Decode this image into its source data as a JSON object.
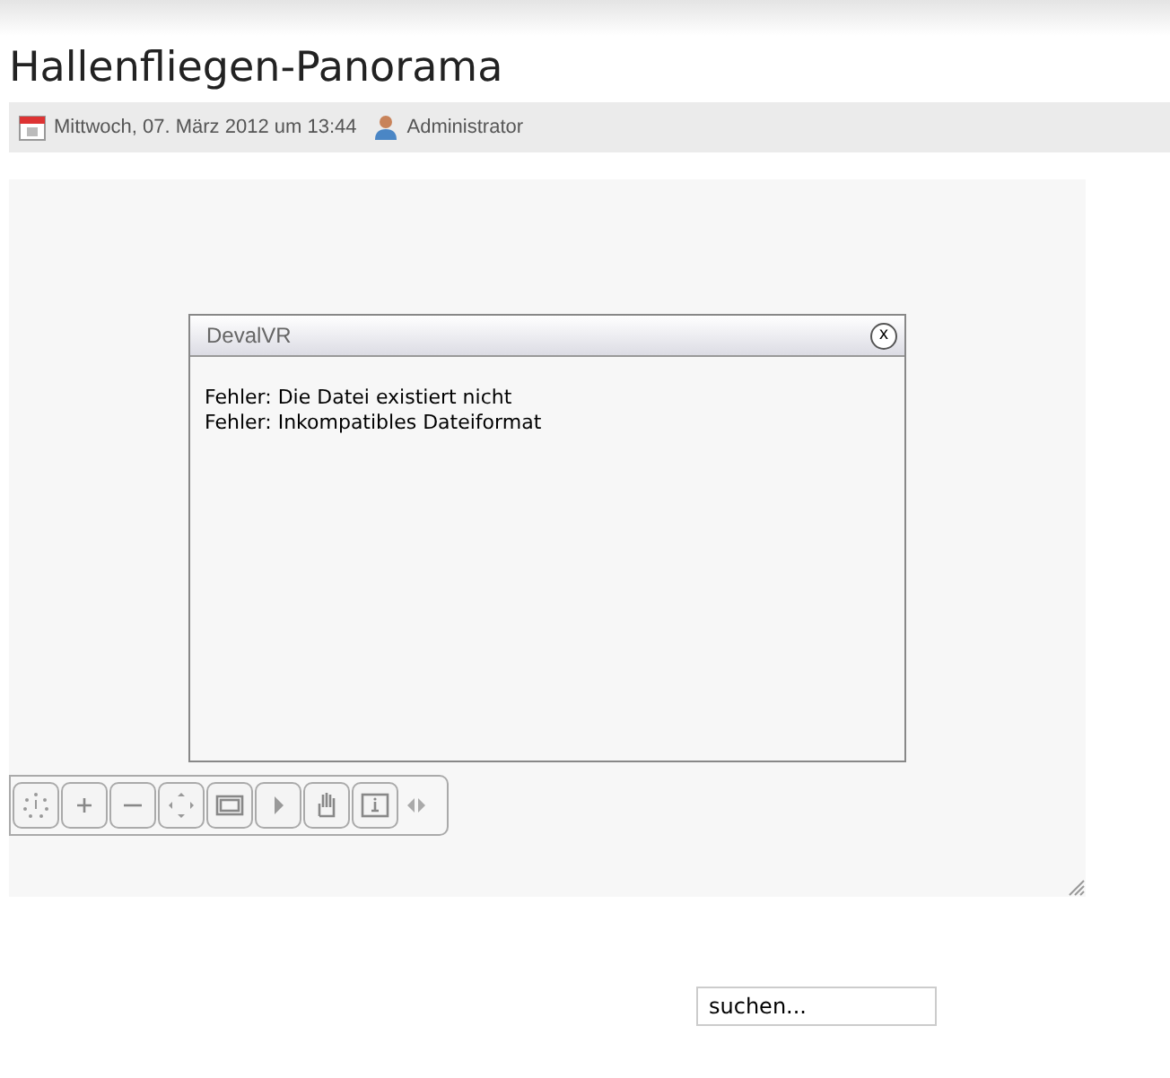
{
  "article": {
    "title": "Hallenfliegen-Panorama",
    "date": "Mittwoch, 07. März 2012 um 13:44",
    "author": "Administrator"
  },
  "viewer": {
    "dialog": {
      "title": "DevalVR",
      "close": "x",
      "messages": [
        "Fehler: Die Datei existiert nicht",
        "Fehler: Inkompatibles Dateiformat"
      ]
    },
    "toolbar": [
      {
        "kind": "autorotate"
      },
      {
        "kind": "zoom-in"
      },
      {
        "kind": "zoom-out"
      },
      {
        "kind": "move"
      },
      {
        "kind": "fullscreen"
      },
      {
        "kind": "play"
      },
      {
        "kind": "hand"
      },
      {
        "kind": "info"
      },
      {
        "kind": "collapse"
      }
    ]
  },
  "search": {
    "value": "suchen..."
  }
}
